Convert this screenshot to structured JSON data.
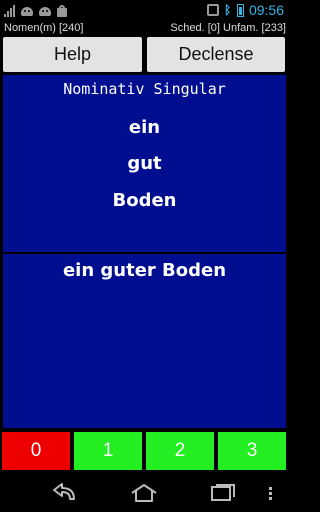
{
  "status_bar": {
    "left_icons": [
      "signal-icon",
      "android-icon",
      "android-icon",
      "shopping-bag-icon"
    ],
    "right_icons": [
      "vibrate-icon",
      "bluetooth-icon",
      "battery-icon"
    ],
    "time": "09:56",
    "accent_color": "#33b5e5"
  },
  "info": {
    "left": "Nomen(m) [240]",
    "right": "Sched. [0] Unfam. [233]"
  },
  "buttons": {
    "help": "Help",
    "declense": "Declense"
  },
  "card": {
    "case_title": "Nominativ Singular",
    "words": [
      "ein",
      "gut",
      "Boden"
    ],
    "answer": "ein guter Boden",
    "panel_color": "#000e8f"
  },
  "ratings": [
    {
      "label": "0",
      "color": "#ee0000"
    },
    {
      "label": "1",
      "color": "#22ee22"
    },
    {
      "label": "2",
      "color": "#22ee22"
    },
    {
      "label": "3",
      "color": "#22ee22"
    }
  ],
  "nav_bar": {
    "icons": [
      "back-icon",
      "home-icon",
      "recents-icon",
      "menu-icon"
    ]
  }
}
